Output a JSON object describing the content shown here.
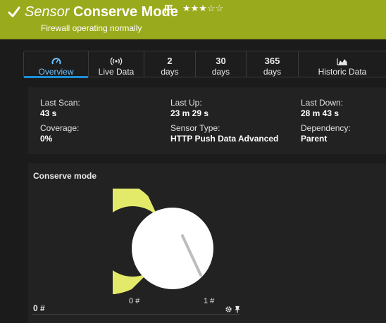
{
  "header": {
    "kind": "Sensor",
    "name": "Conserve Mode",
    "stars": "★★★☆☆",
    "rating": 3,
    "status_message": "Firewall operating normally",
    "bg_color": "#9aaa1d"
  },
  "tabs": [
    {
      "top": "",
      "label": "Overview",
      "icon": "gauge-icon",
      "active": true
    },
    {
      "top": "",
      "label": "Live Data",
      "icon": "radio-waves-icon",
      "active": false
    },
    {
      "top": "2",
      "label": "days",
      "icon": "",
      "active": false
    },
    {
      "top": "30",
      "label": "days",
      "icon": "",
      "active": false
    },
    {
      "top": "365",
      "label": "days",
      "icon": "",
      "active": false
    },
    {
      "top": "",
      "label": "Historic Data",
      "icon": "area-chart-icon",
      "active": false
    }
  ],
  "info": {
    "last_scan": {
      "label": "Last Scan:",
      "value": "43 s"
    },
    "last_up": {
      "label": "Last Up:",
      "value": "23 m 29 s"
    },
    "last_down": {
      "label": "Last Down:",
      "value": "28 m 43 s"
    },
    "coverage": {
      "label": "Coverage:",
      "value": "0%"
    },
    "sensor_type": {
      "label": "Sensor Type:",
      "value": "HTTP Push Data Advanced"
    },
    "dependency": {
      "label": "Dependency:",
      "value": "Parent"
    }
  },
  "channel": {
    "title": "Conserve mode",
    "min_label": "0 #",
    "max_label": "1 #",
    "current_label": "0 #",
    "value": 0,
    "min": 0,
    "max": 1,
    "gauge_color": "#e3ea6a"
  }
}
